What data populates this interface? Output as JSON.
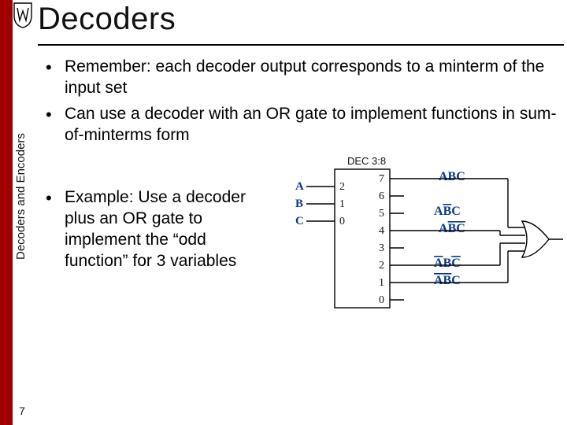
{
  "title": "Decoders",
  "sidebar_label": "Decoders and Encoders",
  "page_number": "7",
  "bullets": [
    "Remember: each decoder output corresponds to a minterm of the input set",
    "Can use a decoder with an OR gate to implement functions in sum-of-minterms form"
  ],
  "example_bullet": "Example: Use a decoder plus an OR gate to implement the “odd function” for 3 variables",
  "diagram": {
    "block_label": "DEC 3:8",
    "inputs": [
      {
        "name": "A",
        "pin": "2"
      },
      {
        "name": "B",
        "pin": "1"
      },
      {
        "name": "C",
        "pin": "0"
      }
    ],
    "outputs": [
      {
        "pin": "7",
        "term_plain": "ABC",
        "term_bars": ""
      },
      {
        "pin": "6",
        "term_plain": "",
        "term_bars": ""
      },
      {
        "pin": "5",
        "term_plain": "A",
        "term_tail": "C",
        "term_bars": "B"
      },
      {
        "pin": "4",
        "term_plain": "A",
        "term_tail": "",
        "term_bars": "BC"
      },
      {
        "pin": "3",
        "term_plain": "",
        "term_bars": ""
      },
      {
        "pin": "2",
        "term_plain": "",
        "term_mid": "B",
        "term_bars_lead": "A",
        "term_bars_tail": "C"
      },
      {
        "pin": "1",
        "term_plain": "",
        "term_tail": "C",
        "term_bars": "AB"
      },
      {
        "pin": "0",
        "term_plain": "",
        "term_bars": ""
      }
    ]
  }
}
